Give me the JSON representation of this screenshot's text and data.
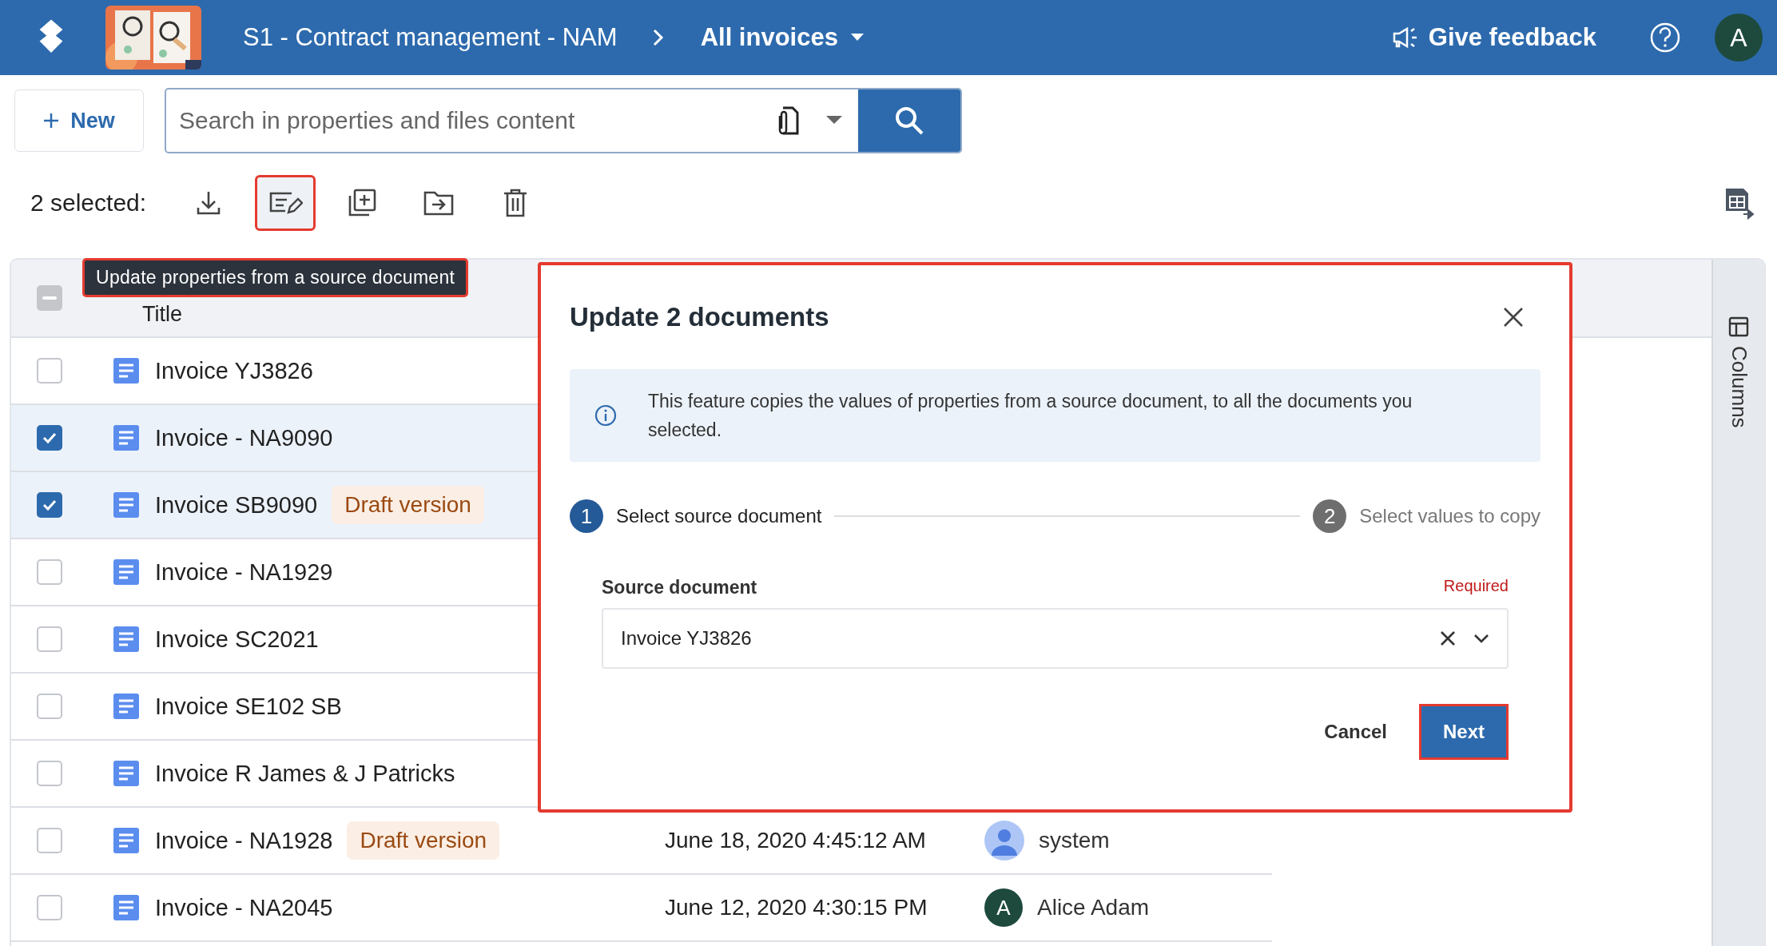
{
  "header": {
    "workspace": "S1 - Contract management - NAM",
    "view": "All invoices",
    "feedback": "Give feedback",
    "avatar": "A"
  },
  "toolbar": {
    "new_button": "New",
    "search": {
      "placeholder": "Search in properties and files content"
    }
  },
  "selection": {
    "label": "2 selected:",
    "actions": [
      {
        "kind": "download",
        "highlighted": false
      },
      {
        "kind": "edit",
        "highlighted": true
      },
      {
        "kind": "add",
        "highlighted": false
      },
      {
        "kind": "move",
        "highlighted": false
      },
      {
        "kind": "delete",
        "highlighted": false
      }
    ]
  },
  "tooltip": "Update properties from a source document",
  "table": {
    "columns": [
      "Title"
    ],
    "indeterminate": true,
    "rows": [
      {
        "title": "Invoice YJ3826",
        "checked": false
      },
      {
        "title": "Invoice - NA9090",
        "checked": true
      },
      {
        "title": "Invoice SB9090",
        "checked": true,
        "badge": "Draft version"
      },
      {
        "title": "Invoice - NA1929",
        "checked": false
      },
      {
        "title": "Invoice SC2021",
        "checked": false
      },
      {
        "title": "Invoice SE102 SB",
        "checked": false
      },
      {
        "title": "Invoice R James & J Patricks",
        "checked": false
      },
      {
        "title": "Invoice - NA1928",
        "checked": false,
        "badge": "Draft version",
        "date": "June 18, 2020 4:45:12 AM",
        "user": "system",
        "avatar": {
          "kind": "person"
        }
      },
      {
        "title": "Invoice - NA2045",
        "checked": false,
        "date": "June 12, 2020 4:30:15 PM",
        "user": "Alice Adam",
        "avatar": {
          "kind": "initial",
          "text": "A"
        }
      }
    ]
  },
  "side_panel": {
    "label": "Columns"
  },
  "dialog": {
    "title": "Update 2 documents",
    "info": "This feature copies the values of properties from a source document, to all the documents you selected.",
    "steps": [
      {
        "number": "1",
        "label": "Select source document",
        "selected": true
      },
      {
        "number": "2",
        "label": "Select values to copy",
        "selected": false
      }
    ],
    "field": {
      "label": "Source document",
      "required": "Required",
      "value": "Invoice YJ3826"
    },
    "cancel": "Cancel",
    "next": "Next",
    "next_highlighted": true
  }
}
